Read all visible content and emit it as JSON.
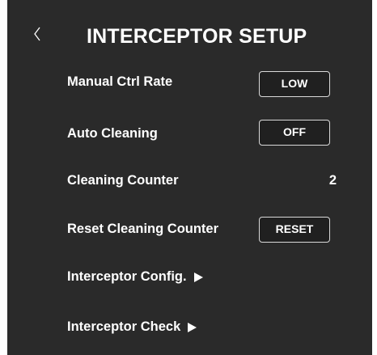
{
  "header": {
    "title": "INTERCEPTOR SETUP",
    "back_icon": "chevron-left-icon"
  },
  "settings": {
    "manual_ctrl_rate": {
      "label": "Manual Ctrl Rate",
      "value": "LOW"
    },
    "auto_cleaning": {
      "label": "Auto Cleaning",
      "value": "OFF"
    },
    "cleaning_counter": {
      "label": "Cleaning Counter",
      "value": "2"
    },
    "reset_cleaning_counter": {
      "label": "Reset Cleaning Counter",
      "button": "RESET"
    }
  },
  "links": {
    "interceptor_config": {
      "label": "Interceptor Config.",
      "icon": "triangle-right-icon"
    },
    "interceptor_check": {
      "label": "Interceptor Check",
      "icon": "triangle-right-icon"
    }
  },
  "colors": {
    "panel_background": "#2a2a2a",
    "text": "#ffffff",
    "button_border": "#d9d9d9"
  }
}
